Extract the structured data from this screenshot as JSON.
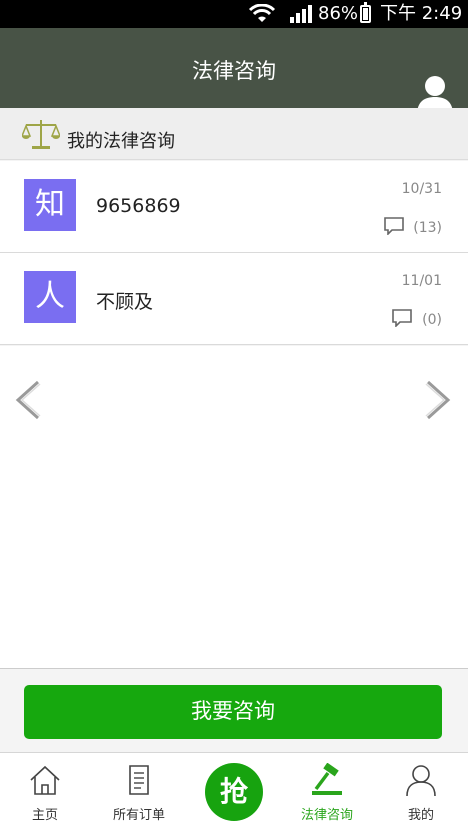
{
  "status_bar": {
    "battery": "86%",
    "time": "下午 2:49"
  },
  "header": {
    "title": "法律咨询"
  },
  "section": {
    "title": "我的法律咨询"
  },
  "consultations": [
    {
      "avatar_char": "知",
      "name": "9656869",
      "date": "10/31",
      "comments": "(13)"
    },
    {
      "avatar_char": "人",
      "name": "不顾及",
      "date": "11/01",
      "comments": "(0)"
    }
  ],
  "actions": {
    "consult_label": "我要咨询"
  },
  "tabs": [
    {
      "label": "主页",
      "icon": "home-icon"
    },
    {
      "label": "所有订单",
      "icon": "orders-icon"
    },
    {
      "label": "抢",
      "icon": "grab-icon"
    },
    {
      "label": "法律咨询",
      "icon": "gavel-icon",
      "active": true
    },
    {
      "label": "我的",
      "icon": "user-icon"
    }
  ],
  "colors": {
    "header_bg": "#485346",
    "accent_green": "#16a80e",
    "avatar_purple": "#7a6ef1"
  }
}
